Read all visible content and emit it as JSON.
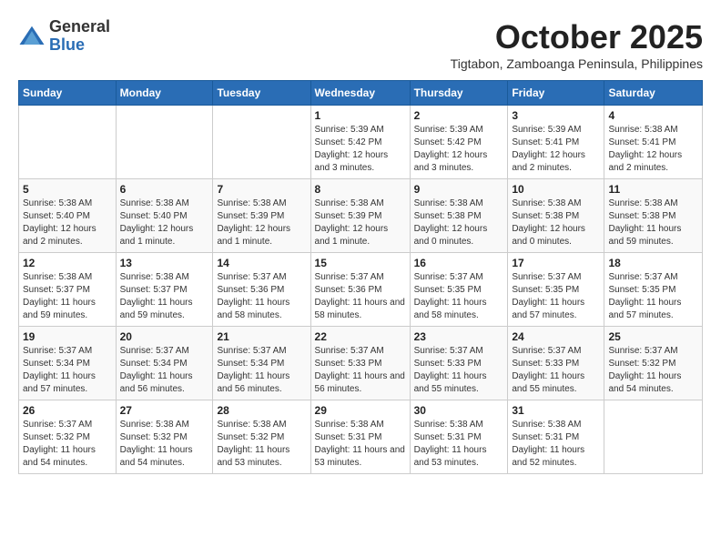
{
  "header": {
    "logo_general": "General",
    "logo_blue": "Blue",
    "month_title": "October 2025",
    "location": "Tigtabon, Zamboanga Peninsula, Philippines"
  },
  "weekdays": [
    "Sunday",
    "Monday",
    "Tuesday",
    "Wednesday",
    "Thursday",
    "Friday",
    "Saturday"
  ],
  "weeks": [
    [
      {
        "day": "",
        "info": ""
      },
      {
        "day": "",
        "info": ""
      },
      {
        "day": "",
        "info": ""
      },
      {
        "day": "1",
        "info": "Sunrise: 5:39 AM\nSunset: 5:42 PM\nDaylight: 12 hours and 3 minutes."
      },
      {
        "day": "2",
        "info": "Sunrise: 5:39 AM\nSunset: 5:42 PM\nDaylight: 12 hours and 3 minutes."
      },
      {
        "day": "3",
        "info": "Sunrise: 5:39 AM\nSunset: 5:41 PM\nDaylight: 12 hours and 2 minutes."
      },
      {
        "day": "4",
        "info": "Sunrise: 5:38 AM\nSunset: 5:41 PM\nDaylight: 12 hours and 2 minutes."
      }
    ],
    [
      {
        "day": "5",
        "info": "Sunrise: 5:38 AM\nSunset: 5:40 PM\nDaylight: 12 hours and 2 minutes."
      },
      {
        "day": "6",
        "info": "Sunrise: 5:38 AM\nSunset: 5:40 PM\nDaylight: 12 hours and 1 minute."
      },
      {
        "day": "7",
        "info": "Sunrise: 5:38 AM\nSunset: 5:39 PM\nDaylight: 12 hours and 1 minute."
      },
      {
        "day": "8",
        "info": "Sunrise: 5:38 AM\nSunset: 5:39 PM\nDaylight: 12 hours and 1 minute."
      },
      {
        "day": "9",
        "info": "Sunrise: 5:38 AM\nSunset: 5:38 PM\nDaylight: 12 hours and 0 minutes."
      },
      {
        "day": "10",
        "info": "Sunrise: 5:38 AM\nSunset: 5:38 PM\nDaylight: 12 hours and 0 minutes."
      },
      {
        "day": "11",
        "info": "Sunrise: 5:38 AM\nSunset: 5:38 PM\nDaylight: 11 hours and 59 minutes."
      }
    ],
    [
      {
        "day": "12",
        "info": "Sunrise: 5:38 AM\nSunset: 5:37 PM\nDaylight: 11 hours and 59 minutes."
      },
      {
        "day": "13",
        "info": "Sunrise: 5:38 AM\nSunset: 5:37 PM\nDaylight: 11 hours and 59 minutes."
      },
      {
        "day": "14",
        "info": "Sunrise: 5:37 AM\nSunset: 5:36 PM\nDaylight: 11 hours and 58 minutes."
      },
      {
        "day": "15",
        "info": "Sunrise: 5:37 AM\nSunset: 5:36 PM\nDaylight: 11 hours and 58 minutes."
      },
      {
        "day": "16",
        "info": "Sunrise: 5:37 AM\nSunset: 5:35 PM\nDaylight: 11 hours and 58 minutes."
      },
      {
        "day": "17",
        "info": "Sunrise: 5:37 AM\nSunset: 5:35 PM\nDaylight: 11 hours and 57 minutes."
      },
      {
        "day": "18",
        "info": "Sunrise: 5:37 AM\nSunset: 5:35 PM\nDaylight: 11 hours and 57 minutes."
      }
    ],
    [
      {
        "day": "19",
        "info": "Sunrise: 5:37 AM\nSunset: 5:34 PM\nDaylight: 11 hours and 57 minutes."
      },
      {
        "day": "20",
        "info": "Sunrise: 5:37 AM\nSunset: 5:34 PM\nDaylight: 11 hours and 56 minutes."
      },
      {
        "day": "21",
        "info": "Sunrise: 5:37 AM\nSunset: 5:34 PM\nDaylight: 11 hours and 56 minutes."
      },
      {
        "day": "22",
        "info": "Sunrise: 5:37 AM\nSunset: 5:33 PM\nDaylight: 11 hours and 56 minutes."
      },
      {
        "day": "23",
        "info": "Sunrise: 5:37 AM\nSunset: 5:33 PM\nDaylight: 11 hours and 55 minutes."
      },
      {
        "day": "24",
        "info": "Sunrise: 5:37 AM\nSunset: 5:33 PM\nDaylight: 11 hours and 55 minutes."
      },
      {
        "day": "25",
        "info": "Sunrise: 5:37 AM\nSunset: 5:32 PM\nDaylight: 11 hours and 54 minutes."
      }
    ],
    [
      {
        "day": "26",
        "info": "Sunrise: 5:37 AM\nSunset: 5:32 PM\nDaylight: 11 hours and 54 minutes."
      },
      {
        "day": "27",
        "info": "Sunrise: 5:38 AM\nSunset: 5:32 PM\nDaylight: 11 hours and 54 minutes."
      },
      {
        "day": "28",
        "info": "Sunrise: 5:38 AM\nSunset: 5:32 PM\nDaylight: 11 hours and 53 minutes."
      },
      {
        "day": "29",
        "info": "Sunrise: 5:38 AM\nSunset: 5:31 PM\nDaylight: 11 hours and 53 minutes."
      },
      {
        "day": "30",
        "info": "Sunrise: 5:38 AM\nSunset: 5:31 PM\nDaylight: 11 hours and 53 minutes."
      },
      {
        "day": "31",
        "info": "Sunrise: 5:38 AM\nSunset: 5:31 PM\nDaylight: 11 hours and 52 minutes."
      },
      {
        "day": "",
        "info": ""
      }
    ]
  ]
}
